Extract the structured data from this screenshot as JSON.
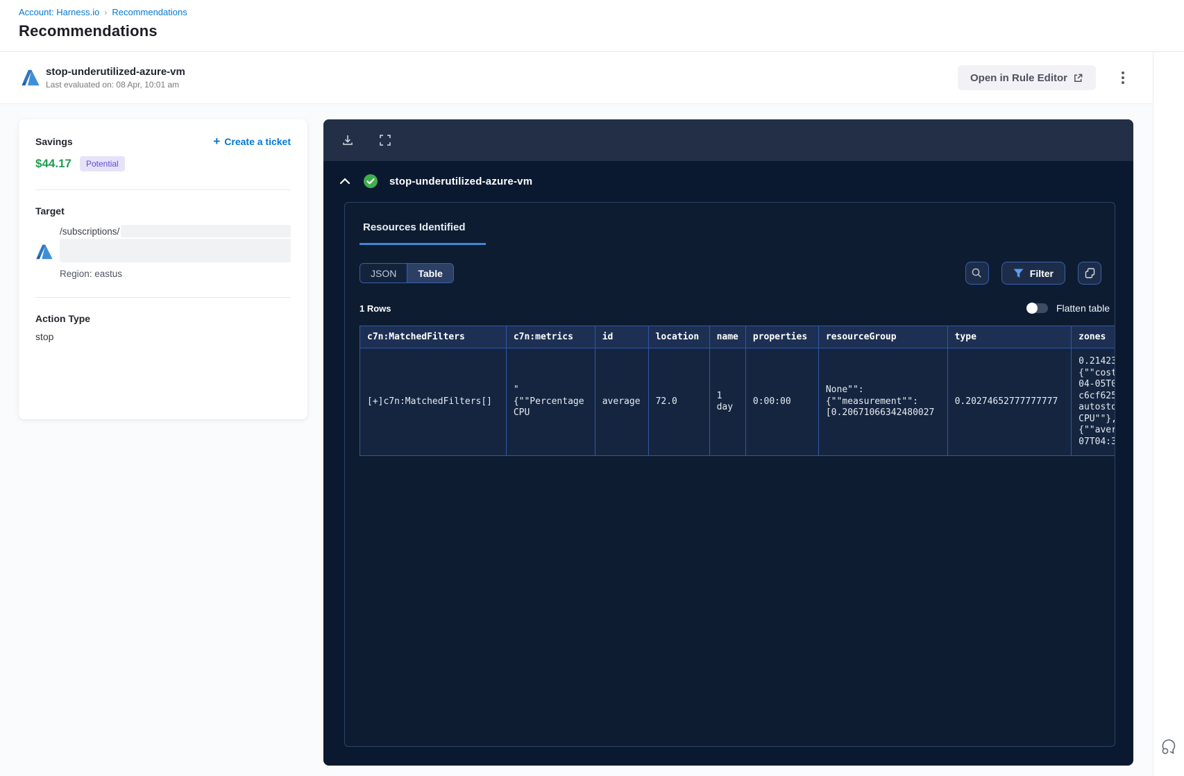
{
  "breadcrumb": {
    "account": "Account: Harness.io",
    "separator": "›",
    "current": "Recommendations"
  },
  "page": {
    "title": "Recommendations"
  },
  "rule_header": {
    "name": "stop-underutilized-azure-vm",
    "last_evaluated": "Last evaluated on: 08 Apr, 10:01 am",
    "open_editor_label": "Open in Rule Editor"
  },
  "savings_card": {
    "savings_label": "Savings",
    "amount": "$44.17",
    "badge": "Potential",
    "create_ticket_label": "Create a ticket",
    "create_ticket_plus": "+",
    "target_label": "Target",
    "target_path": "/subscriptions/",
    "region": "Region: eastus",
    "action_type_label": "Action Type",
    "action_type_value": "stop"
  },
  "results_panel": {
    "rule_name": "stop-underutilized-azure-vm",
    "tab_label": "Resources Identified",
    "view_toggle": {
      "json_label": "JSON",
      "table_label": "Table",
      "active": "Table"
    },
    "filter_label": "Filter",
    "rows_count": "1 Rows",
    "flatten_label": "Flatten table",
    "flatten_state": "off",
    "table": {
      "columns": [
        "c7n:MatchedFilters",
        "c7n:metrics",
        "id",
        "location",
        "name",
        "properties",
        "resourceGroup",
        "type",
        "zones"
      ],
      "rows": [
        [
          "[+]c7n:MatchedFilters[]",
          "\"\n{\"\"Percentage\nCPU",
          "average",
          "72.0",
          "1\nday",
          "0:00:00",
          "None\"\":\n{\"\"measurement\"\":\n[0.20671066342480027",
          "0.20274652777777777",
          "0.21423\n{\"\"cost\n04-05T0\nc6cf625\nautosto\nCPU\"\"},\n{\"\"aver\n07T04:3"
        ]
      ]
    }
  },
  "icons": {
    "download": "download-tray",
    "fullscreen": "expand-corners",
    "search": "magnifier",
    "filter": "funnel",
    "copy": "duplicate",
    "check": "check-circle",
    "chevron_up": "collapse",
    "kebab": "three-dots",
    "external_link": "open-in-new",
    "chat": "feedback-bubble"
  },
  "colors": {
    "accent_blue": "#0278d5",
    "savings_green": "#1f9e53",
    "badge_bg": "#e6e2fa",
    "badge_text": "#5c4bd3",
    "panel_toolbar": "#222f46",
    "panel_body": "#0b1930",
    "table_border": "#2f57a8",
    "table_header_bg": "#1d3054",
    "cell_link": "#79b8f3",
    "tab_underline": "#4285d8",
    "check_green": "#3fae4f"
  }
}
